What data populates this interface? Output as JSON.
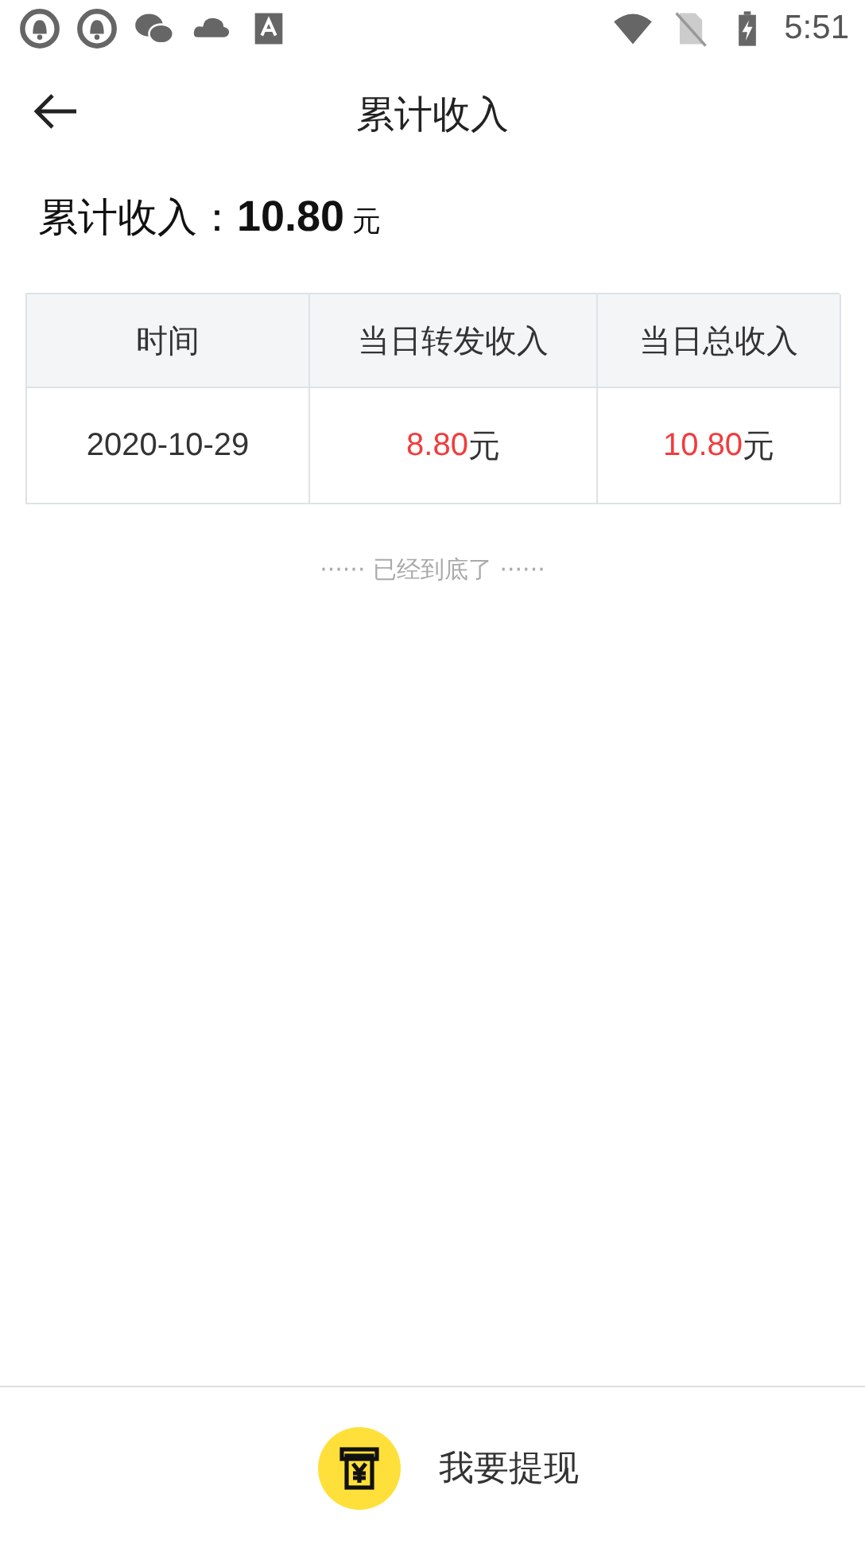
{
  "status_bar": {
    "time": "5:51"
  },
  "header": {
    "title": "累计收入"
  },
  "summary": {
    "label": "累计收入：",
    "amount": "10.80",
    "unit": "元"
  },
  "table": {
    "columns": [
      "时间",
      "当日转发收入",
      "当日总收入"
    ],
    "rows": [
      {
        "date": "2020-10-29",
        "forward_amount": "8.80",
        "forward_unit": "元",
        "total_amount": "10.80",
        "total_unit": "元"
      }
    ]
  },
  "end_note": "······ 已经到底了 ······",
  "withdraw_button": {
    "label": "我要提现"
  }
}
